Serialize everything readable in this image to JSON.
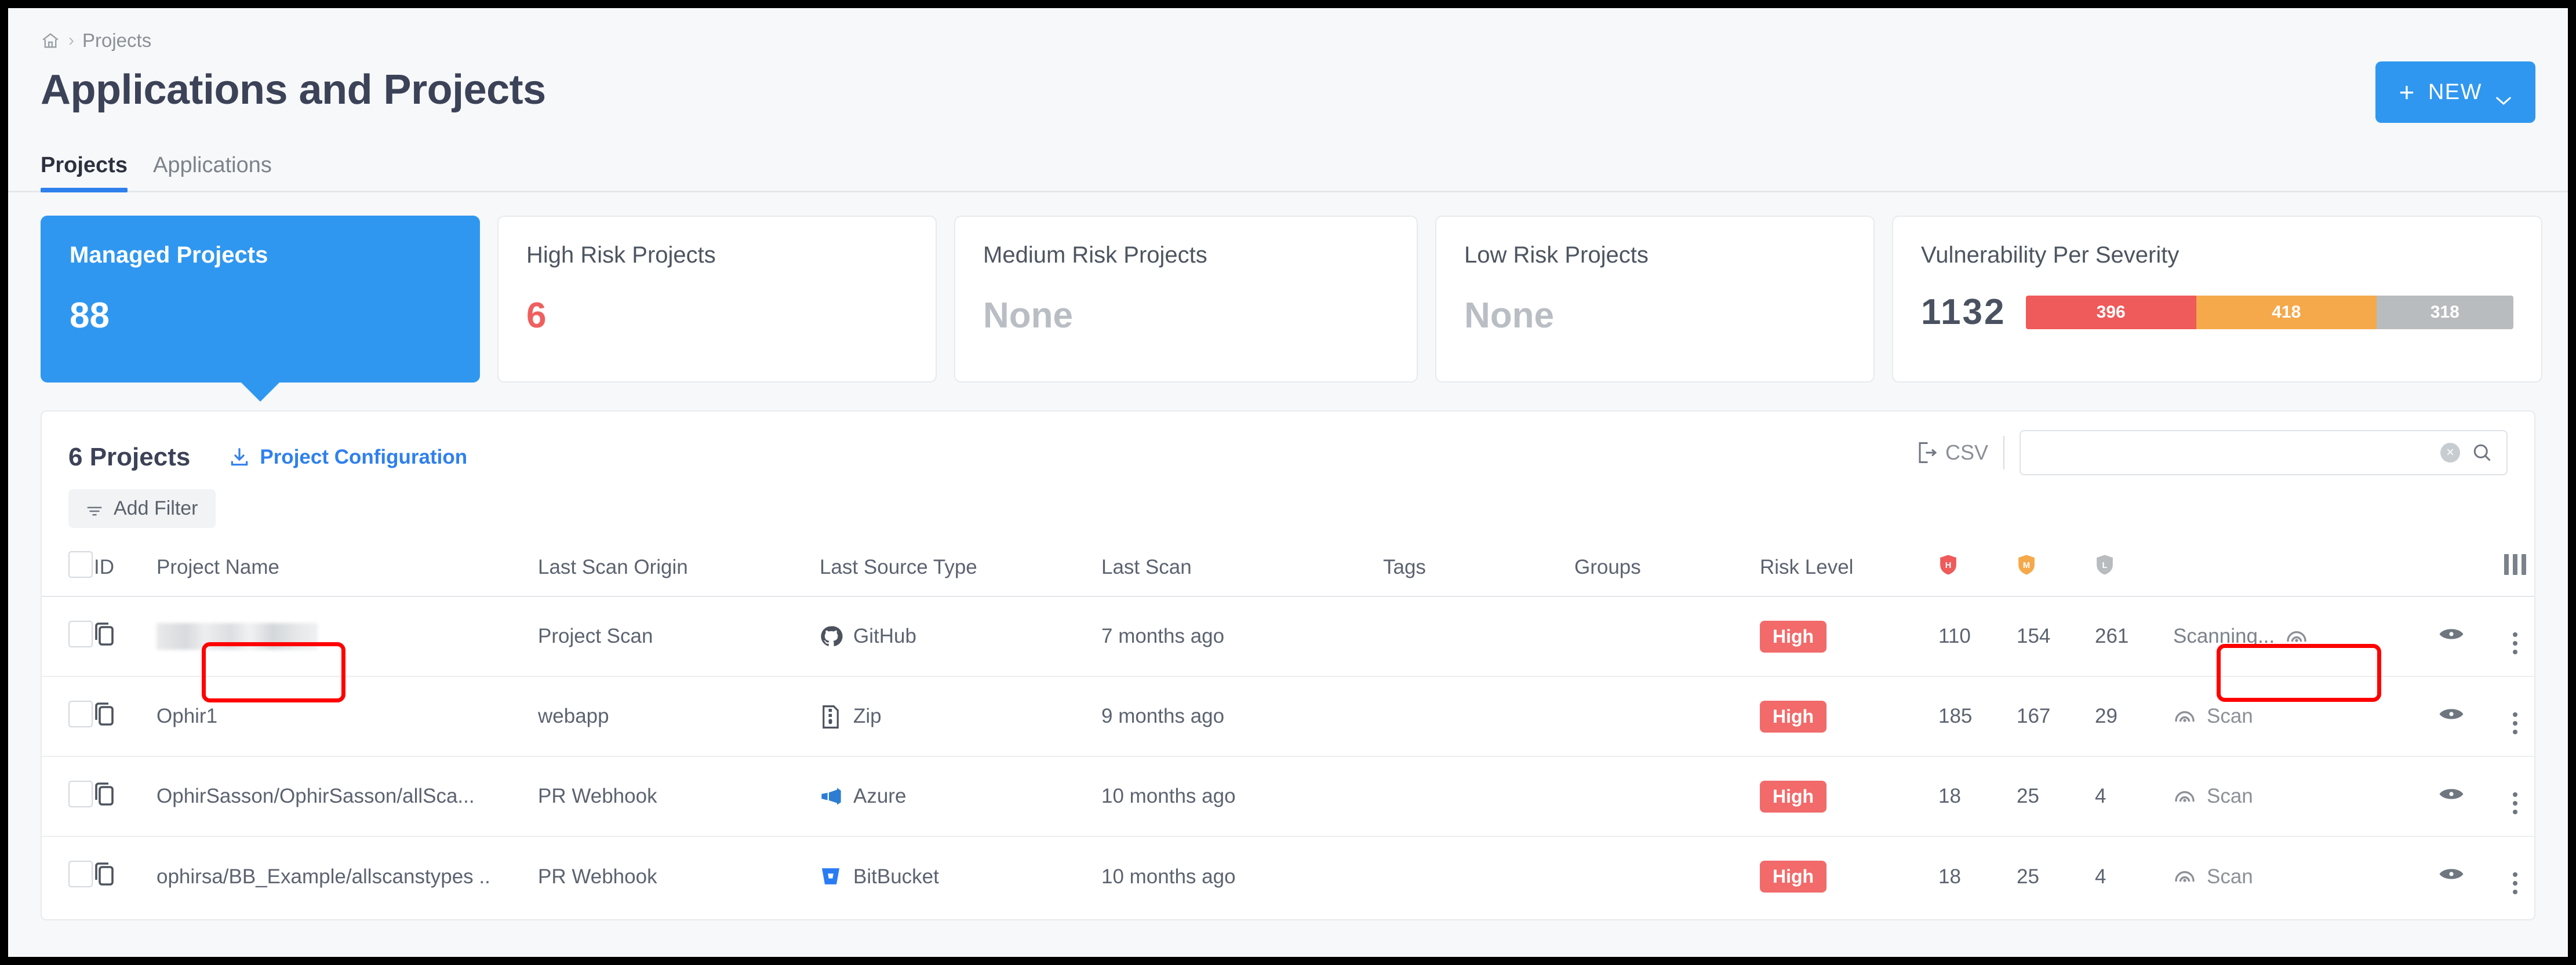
{
  "breadcrumb": {
    "home_icon": "home-icon",
    "separator": "›",
    "current": "Projects"
  },
  "header": {
    "title": "Applications and Projects",
    "new_button": {
      "plus": "+",
      "label": "NEW",
      "caret_icon": "chevron-down-icon"
    }
  },
  "tabs": [
    {
      "label": "Projects",
      "active": true
    },
    {
      "label": "Applications",
      "active": false
    }
  ],
  "cards": [
    {
      "title": "Managed Projects",
      "value": "88",
      "style": "active"
    },
    {
      "title": "High Risk Projects",
      "value": "6",
      "style": "red"
    },
    {
      "title": "Medium Risk Projects",
      "value": "None",
      "style": "none"
    },
    {
      "title": "Low Risk Projects",
      "value": "None",
      "style": "none"
    }
  ],
  "vulnerability_card": {
    "title": "Vulnerability Per Severity",
    "total": "1132",
    "segments": [
      {
        "label": "396",
        "color": "#ef5a5a",
        "value": 396
      },
      {
        "label": "418",
        "color": "#f5a94b",
        "value": 418
      },
      {
        "label": "318",
        "color": "#b9bcbe",
        "value": 318
      }
    ]
  },
  "toolbar": {
    "projects_count": "6 Projects",
    "project_configuration": "Project Configuration",
    "download_icon": "download-icon",
    "csv_label": "CSV",
    "csv_icon": "export-csv-icon",
    "search_value": "",
    "search_placeholder": "",
    "clear_icon": "×",
    "search_icon": "search-icon",
    "add_filter": "Add Filter",
    "filter_icon": "filter-icon"
  },
  "table": {
    "columns": [
      "",
      "ID",
      "Project Name",
      "Last Scan Origin",
      "Last Source Type",
      "Last Scan",
      "Tags",
      "Groups",
      "Risk Level",
      "H",
      "M",
      "L",
      "",
      "",
      ""
    ],
    "severity_headers": [
      {
        "letter": "H",
        "color": "#ef5a5a",
        "name": "shield-high-icon"
      },
      {
        "letter": "M",
        "color": "#f5a94b",
        "name": "shield-medium-icon"
      },
      {
        "letter": "L",
        "color": "#b9bcbe",
        "name": "shield-low-icon"
      }
    ],
    "columns_settings_icon": "columns-settings-icon",
    "rows": [
      {
        "name": "",
        "redacted": true,
        "origin": "Project Scan",
        "source_type": "GitHub",
        "source_icon": "github-icon",
        "last_scan": "7 months ago",
        "tags": "",
        "groups": "",
        "risk": "High",
        "high": "110",
        "medium": "154",
        "low": "261",
        "action": "Scanning...",
        "action_state": "scanning",
        "action_icon": "radar-icon",
        "eye_icon": "eye-icon",
        "menu_icon": "kebab-menu-icon"
      },
      {
        "name": "Ophir1",
        "redacted": false,
        "origin": "webapp",
        "source_type": "Zip",
        "source_icon": "zip-icon",
        "last_scan": "9 months ago",
        "tags": "",
        "groups": "",
        "risk": "High",
        "high": "185",
        "medium": "167",
        "low": "29",
        "action": "Scan",
        "action_state": "idle",
        "action_icon": "radar-icon",
        "eye_icon": "eye-icon",
        "menu_icon": "kebab-menu-icon"
      },
      {
        "name": "OphirSasson/OphirSasson/allSca...",
        "redacted": false,
        "origin": "PR Webhook",
        "source_type": "Azure",
        "source_icon": "azure-devops-icon",
        "last_scan": "10 months ago",
        "tags": "",
        "groups": "",
        "risk": "High",
        "high": "18",
        "medium": "25",
        "low": "4",
        "action": "Scan",
        "action_state": "idle",
        "action_icon": "radar-icon",
        "eye_icon": "eye-icon",
        "menu_icon": "kebab-menu-icon"
      },
      {
        "name": "ophirsa/BB_Example/allscanstypes  ..",
        "redacted": false,
        "origin": "PR Webhook",
        "source_type": "BitBucket",
        "source_icon": "bitbucket-icon",
        "last_scan": "10 months ago",
        "tags": "",
        "groups": "",
        "risk": "High",
        "high": "18",
        "medium": "25",
        "low": "4",
        "action": "Scan",
        "action_state": "idle",
        "action_icon": "radar-icon",
        "eye_icon": "eye-icon",
        "menu_icon": "kebab-menu-icon"
      }
    ]
  },
  "colors": {
    "accent": "#2f97f0",
    "high": "#f26a6a",
    "medium": "#f5a94b",
    "low": "#b9bcbe",
    "link": "#2f80ed",
    "annotation": "#ff0000"
  }
}
